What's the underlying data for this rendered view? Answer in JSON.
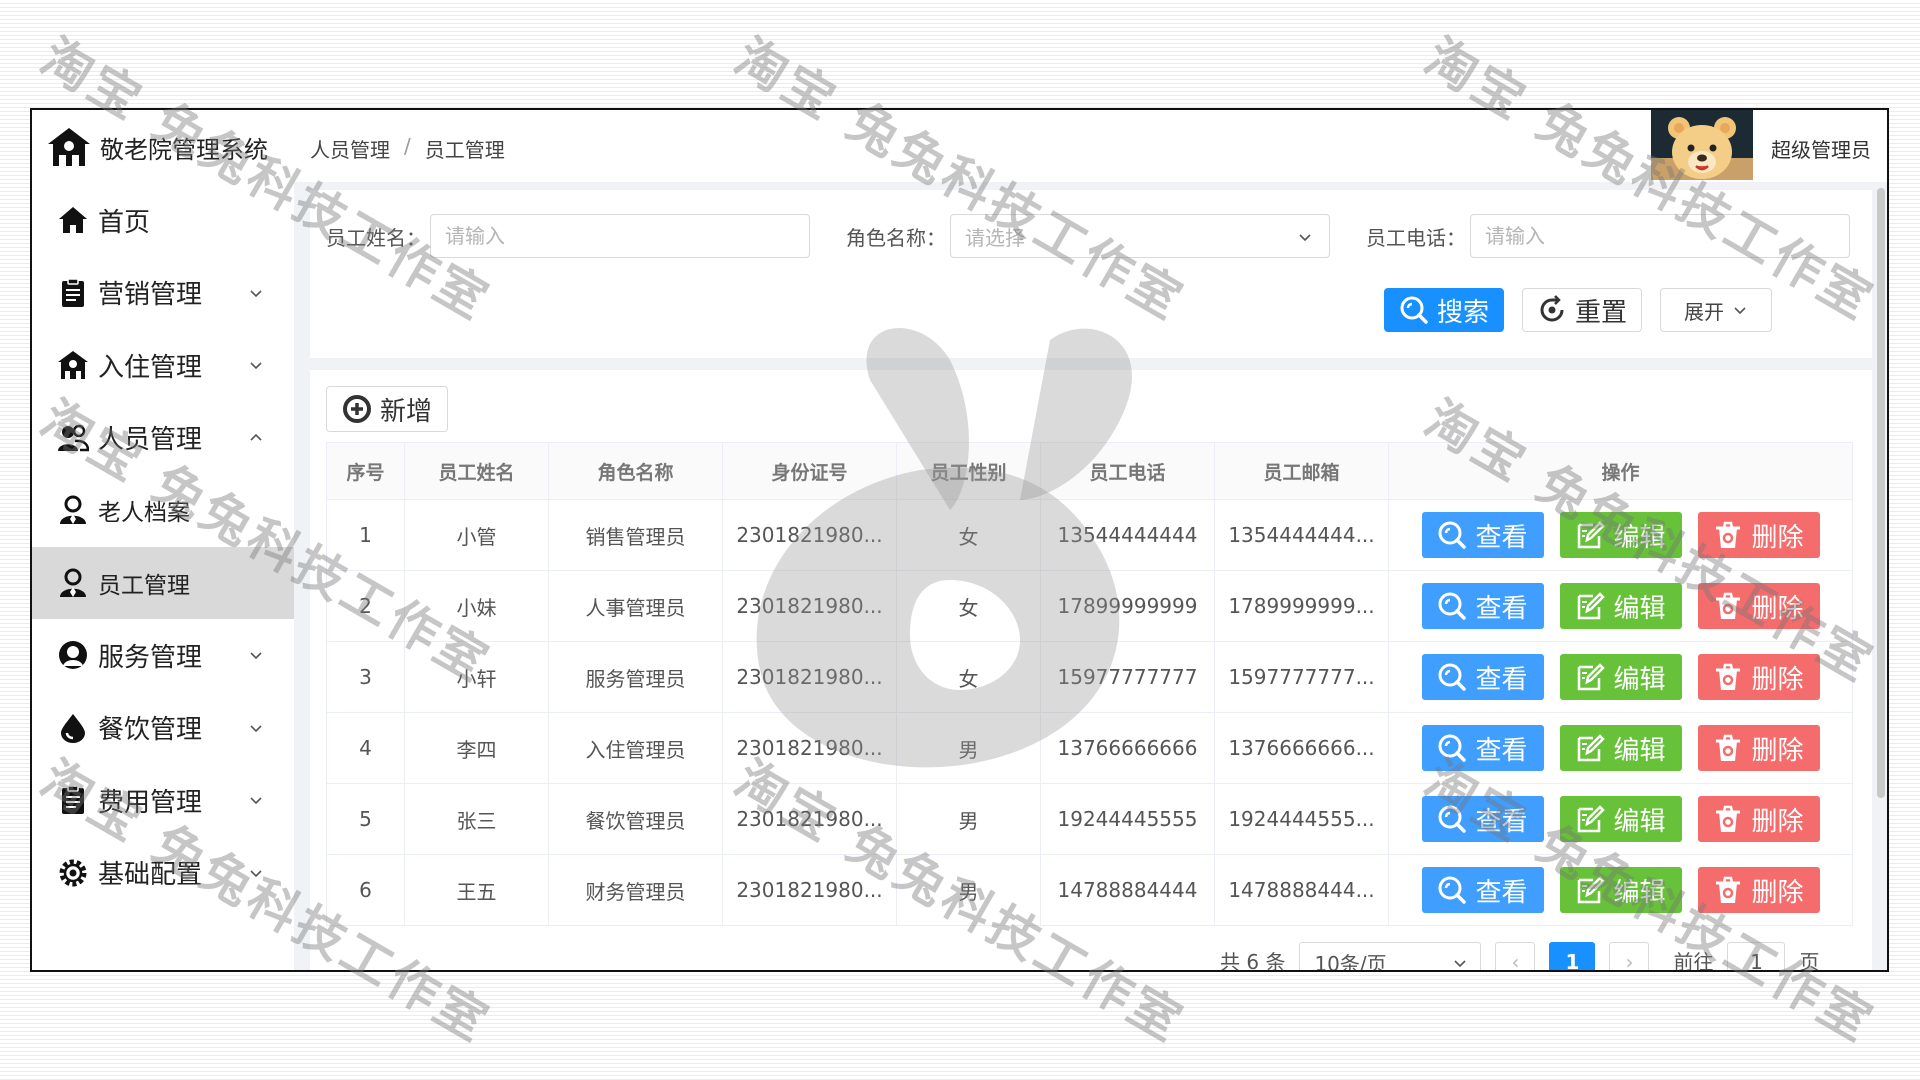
{
  "app": {
    "title": "敬老院管理系统"
  },
  "sidebar": {
    "items": [
      {
        "label": "首页",
        "icon": "home-icon",
        "chevron": ""
      },
      {
        "label": "营销管理",
        "icon": "clipboard-icon",
        "chevron": "down"
      },
      {
        "label": "入住管理",
        "icon": "building-icon",
        "chevron": "down"
      },
      {
        "label": "人员管理",
        "icon": "users-icon",
        "chevron": "up"
      },
      {
        "label": "老人档案",
        "icon": "user-icon",
        "chevron": ""
      },
      {
        "label": "员工管理",
        "icon": "user-icon",
        "chevron": "",
        "active": true
      },
      {
        "label": "服务管理",
        "icon": "service-icon",
        "chevron": "down"
      },
      {
        "label": "餐饮管理",
        "icon": "drop-icon",
        "chevron": "down"
      },
      {
        "label": "费用管理",
        "icon": "clipboard-icon",
        "chevron": "down"
      },
      {
        "label": "基础配置",
        "icon": "gear-icon",
        "chevron": "down"
      }
    ]
  },
  "header": {
    "breadcrumb": [
      "人员管理",
      "员工管理"
    ],
    "breadcrumb_sep": "/",
    "user": "超级管理员"
  },
  "search": {
    "name_label": "员工姓名：",
    "name_placeholder": "请输入",
    "role_label": "角色名称：",
    "role_placeholder": "请选择",
    "phone_label": "员工电话：",
    "phone_placeholder": "请输入",
    "search_label": "搜索",
    "reset_label": "重置",
    "expand_label": "展开"
  },
  "table": {
    "add_label": "新增",
    "columns": [
      "序号",
      "员工姓名",
      "角色名称",
      "身份证号",
      "员工性别",
      "员工电话",
      "员工邮箱",
      "操作"
    ],
    "actions": {
      "view": "查看",
      "edit": "编辑",
      "delete": "删除"
    },
    "rows": [
      {
        "no": "1",
        "name": "小管",
        "role": "销售管理员",
        "id": "2301821980...",
        "gender": "女",
        "phone": "13544444444",
        "email": "1354444444..."
      },
      {
        "no": "2",
        "name": "小妹",
        "role": "人事管理员",
        "id": "2301821980...",
        "gender": "女",
        "phone": "17899999999",
        "email": "1789999999..."
      },
      {
        "no": "3",
        "name": "小轩",
        "role": "服务管理员",
        "id": "2301821980...",
        "gender": "女",
        "phone": "15977777777",
        "email": "1597777777..."
      },
      {
        "no": "4",
        "name": "李四",
        "role": "入住管理员",
        "id": "2301821980...",
        "gender": "男",
        "phone": "13766666666",
        "email": "1376666666..."
      },
      {
        "no": "5",
        "name": "张三",
        "role": "餐饮管理员",
        "id": "2301821980...",
        "gender": "男",
        "phone": "19244445555",
        "email": "1924444555..."
      },
      {
        "no": "6",
        "name": "王五",
        "role": "财务管理员",
        "id": "2301821980...",
        "gender": "男",
        "phone": "14788884444",
        "email": "1478888444..."
      }
    ]
  },
  "pagination": {
    "total": "共 6 条",
    "page_size": "10条/页",
    "prev": "‹",
    "current": "1",
    "next": "›",
    "goto_label": "前往",
    "goto_value": "1",
    "page_suffix": "页"
  },
  "watermark": {
    "text": "淘宝 兔兔科技工作室"
  }
}
